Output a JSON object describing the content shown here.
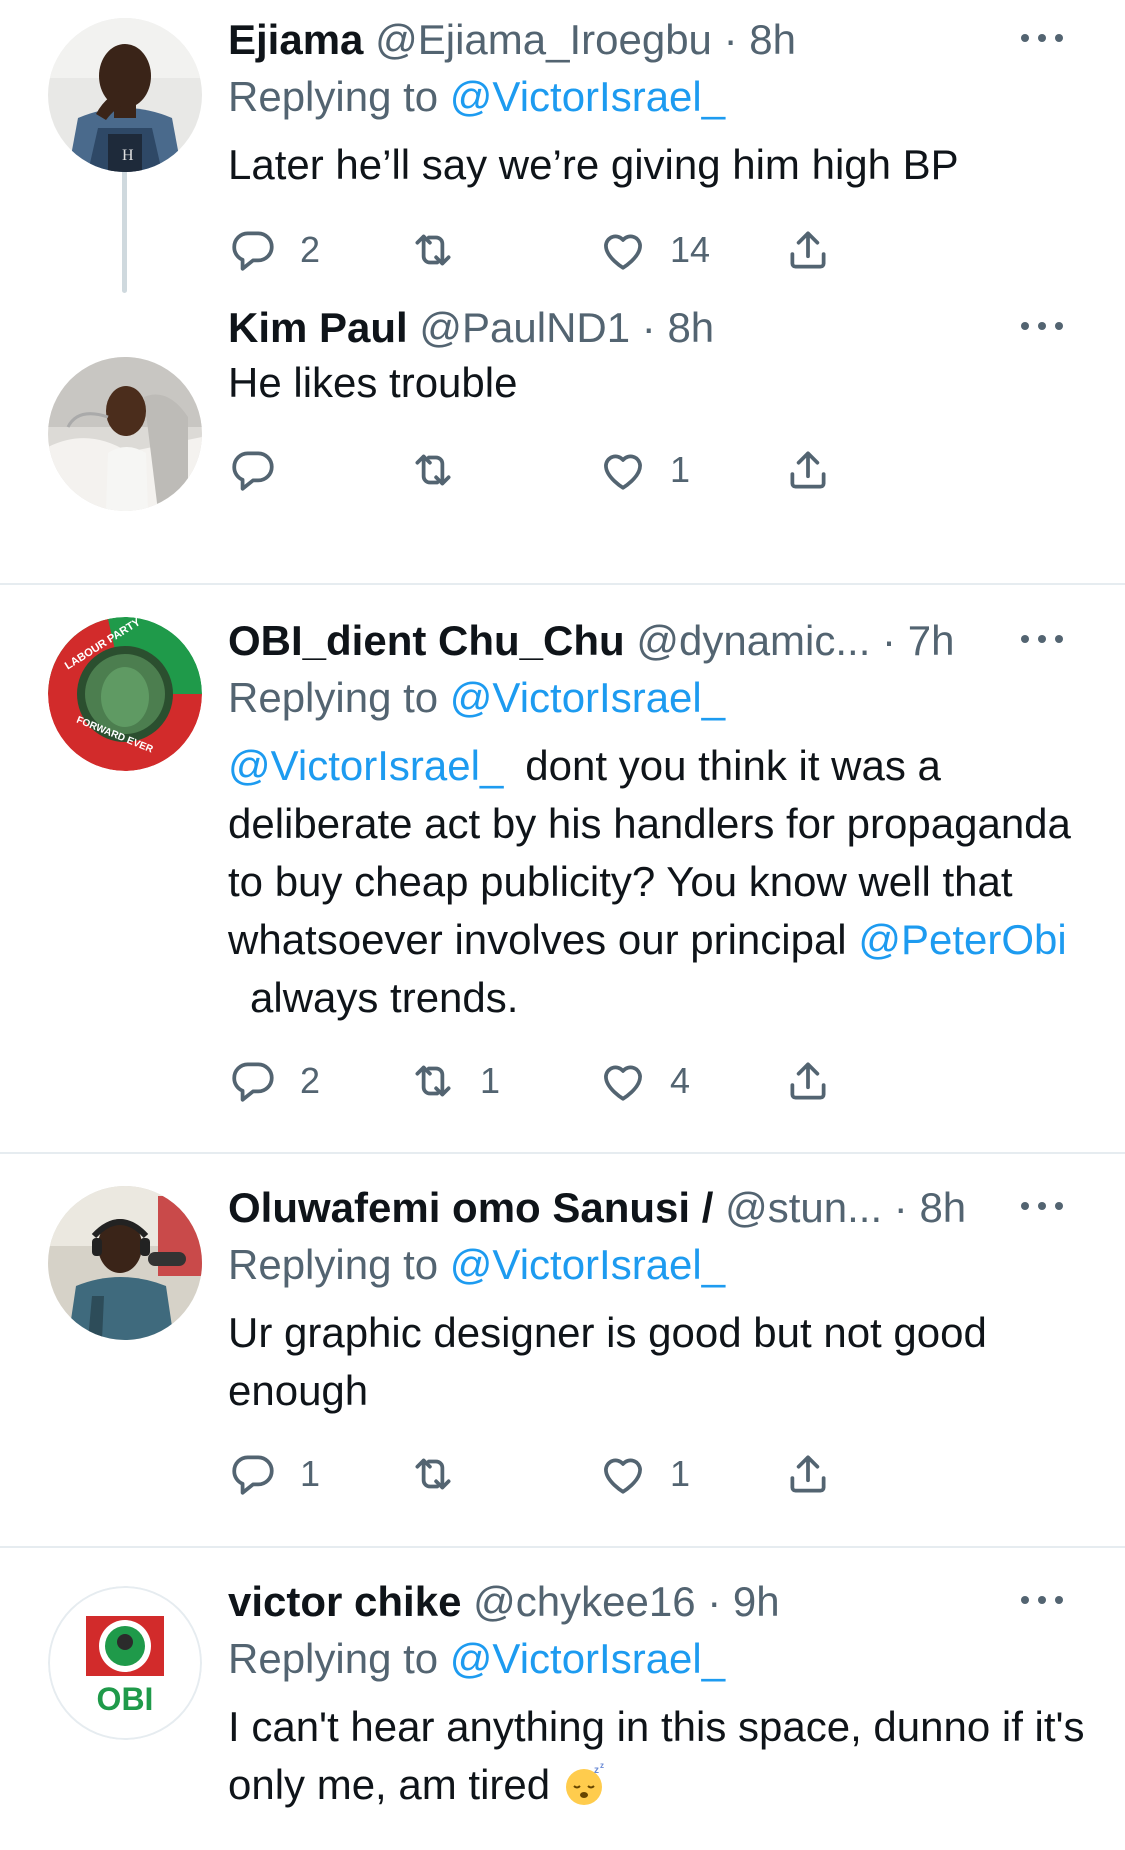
{
  "tweets": [
    {
      "name": "Ejiama",
      "handle": "@Ejiama_Iroegbu",
      "time": "8h",
      "replying_prefix": "Replying to",
      "replying_to": "@VictorIsrael_",
      "text": "Later he’ll say we’re giving him high BP",
      "replies": "2",
      "retweets": "",
      "likes": "14",
      "avatar": "man-in-denim-photo"
    },
    {
      "name": "Kim Paul",
      "handle": "@PaulND1",
      "time": "8h",
      "text": "He likes trouble",
      "replies": "",
      "retweets": "",
      "likes": "1",
      "avatar": "man-selfie-in-car-photo"
    },
    {
      "name": "OBI_dient Chu_Chu",
      "handle": "@dynamic...",
      "time": "7h",
      "replying_prefix": "Replying to",
      "replying_to": "@VictorIsrael_",
      "text_mention1": "@VictorIsrael_",
      "text_part1": "dont you think it was a deliberate act by his handlers for propaganda to buy cheap publicity? You know well that whatsoever involves our principal",
      "text_mention2": "@PeterObi",
      "text_part2": "always trends.",
      "replies": "2",
      "retweets": "1",
      "likes": "4",
      "avatar": "labour-party-logo",
      "logo_top_text": "LABOUR PARTY",
      "logo_bottom_text": "FORWARD EVER"
    },
    {
      "name": "Oluwafemi omo Sanusi /",
      "handle": "@stun...",
      "time": "8h",
      "replying_prefix": "Replying to",
      "replying_to": "@VictorIsrael_",
      "text": "Ur graphic designer is good but not good enough",
      "replies": "1",
      "retweets": "",
      "likes": "1",
      "avatar": "man-with-microphone-photo"
    },
    {
      "name": "victor chike",
      "handle": "@chykee16",
      "time": "9h",
      "replying_prefix": "Replying to",
      "replying_to": "@VictorIsrael_",
      "text": "I can't hear anything in this space, dunno if it's only me, am tired",
      "emoji": "sleeping-face",
      "replies": "",
      "retweets": "",
      "likes": "",
      "avatar": "obi-labour-party-logo",
      "logo_text": "OBI"
    }
  ],
  "colors": {
    "text_primary": "#0f1419",
    "text_secondary": "#536471",
    "link": "#1d9bf0",
    "divider": "#e6ecf0",
    "thread_line": "#cfd9de"
  },
  "icons": [
    "reply-icon",
    "retweet-icon",
    "like-icon",
    "share-icon",
    "more-icon"
  ]
}
